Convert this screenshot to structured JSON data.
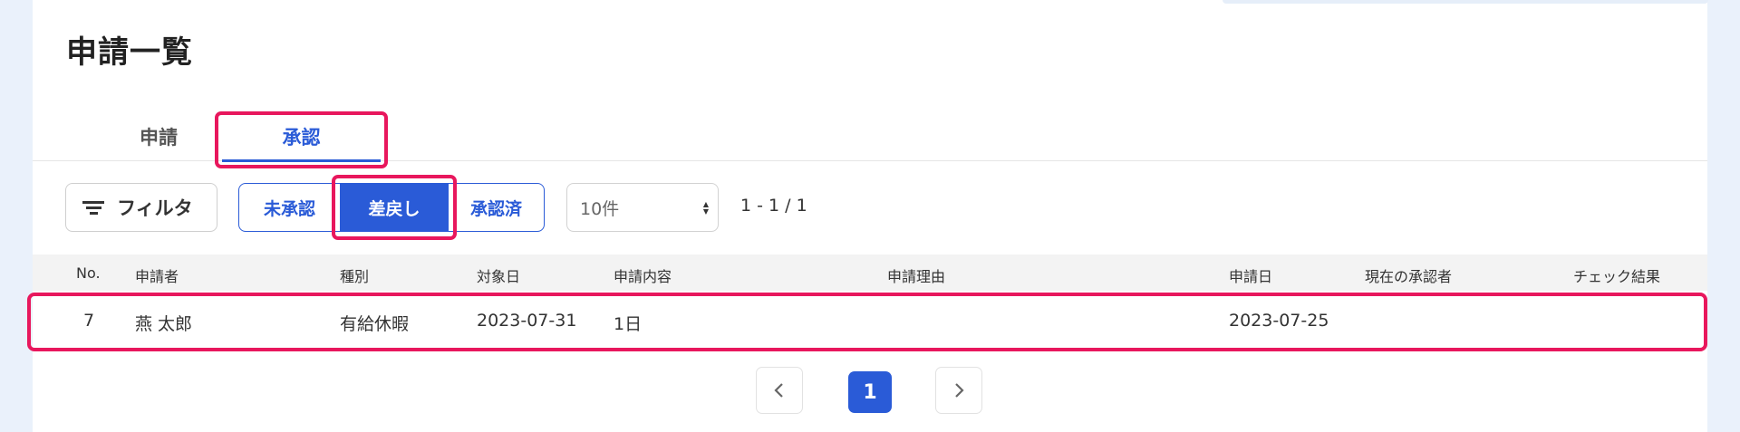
{
  "page": {
    "title": "申請一覧"
  },
  "tabs": [
    {
      "label": "申請",
      "active": false
    },
    {
      "label": "承認",
      "active": true
    }
  ],
  "toolbar": {
    "filter_label": "フィルタ",
    "status_segments": [
      {
        "label": "未承認",
        "active": false
      },
      {
        "label": "差戻し",
        "active": true
      },
      {
        "label": "承認済",
        "active": false
      }
    ],
    "per_page": "10件",
    "count_text": "1 - 1 / 1"
  },
  "table": {
    "columns": [
      "No.",
      "申請者",
      "種別",
      "対象日",
      "申請内容",
      "申請理由",
      "申請日",
      "現在の承認者",
      "チェック結果"
    ],
    "rows": [
      {
        "no": "7",
        "applicant": "燕 太郎",
        "type": "有給休暇",
        "target_date": "2023-07-31",
        "content": "1日",
        "reason": "",
        "apply_date": "2023-07-25",
        "approver": "",
        "check": ""
      }
    ]
  },
  "pagination": {
    "current": "1"
  },
  "colors": {
    "accent": "#2a5bd7",
    "highlight": "#e8175d"
  }
}
